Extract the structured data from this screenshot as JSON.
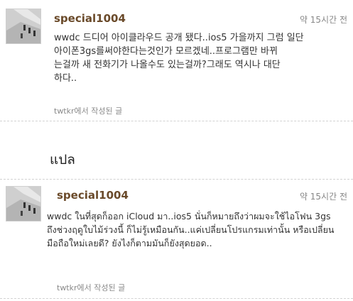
{
  "tweets": [
    {
      "username": "special1004",
      "timestamp": "약 15시간 전",
      "body_lines": [
        "wwdc 드디어 아이클라우드 공개 됐다..ios5 가을까지 그럼 일단",
        "아이폰3gs를써야한다는것인가 모르겠네..프로그램만 바뀌",
        "는걸까 새 전화기가 나올수도 있는걸까?그래도 역시나 대단",
        "하다.."
      ],
      "source": "twtkr에서 작성된 글"
    },
    {
      "username": "special1004",
      "timestamp": "약 15시간 전",
      "body_lines": [
        "wwdc ในที่สุดก็ออก iCloud มา..ios5 นั่นก็หมายถึงว่าผมจะใช้ไอโฟน 3gs",
        "ถึงช่วงฤดูใบไม้ร่วงนี้ ก็ไม่รู้เหมือนกัน..แค่เปลี่ยนโปรแกรมเท่านั้น หรือเปลี่ยน",
        "มือถือใหม่เลยดี? ยังไงก็ตามมันก็ยังสุดยอด.."
      ],
      "source": "twtkr에서 작성된 글"
    }
  ],
  "section_heading": "แปล",
  "icons": {
    "avatar": "avatar-photo-icon"
  }
}
